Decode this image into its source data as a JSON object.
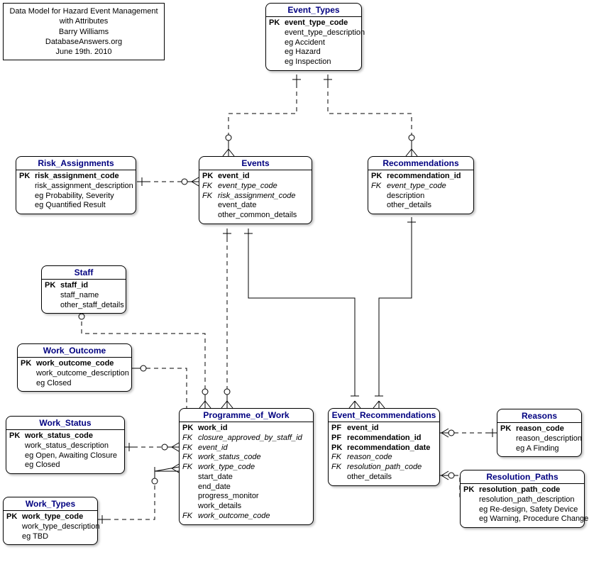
{
  "meta": {
    "line1": "Data Model for Hazard Event Management",
    "line2": "with Attributes",
    "line3": "Barry Williams",
    "line4": "DatabaseAnswers.org",
    "line5": "June 19th. 2010"
  },
  "entities": {
    "event_types": {
      "title": "Event_Types",
      "rows": [
        {
          "key": "PK",
          "attr": "event_type_code",
          "cls": "pk"
        },
        {
          "key": "",
          "attr": "event_type_description"
        },
        {
          "key": "",
          "attr": "eg Accident"
        },
        {
          "key": "",
          "attr": "eg Hazard"
        },
        {
          "key": "",
          "attr": "eg Inspection"
        }
      ]
    },
    "risk_assignments": {
      "title": "Risk_Assignments",
      "rows": [
        {
          "key": "PK",
          "attr": "risk_assignment_code",
          "cls": "pk"
        },
        {
          "key": "",
          "attr": "risk_assignment_description"
        },
        {
          "key": "",
          "attr": "eg Probability, Severity"
        },
        {
          "key": "",
          "attr": "eg Quantified Result"
        }
      ]
    },
    "events": {
      "title": "Events",
      "rows": [
        {
          "key": "PK",
          "attr": "event_id",
          "cls": "pk"
        },
        {
          "key": "FK",
          "attr": "event_type_code",
          "cls": "fk",
          "keycls": "fk"
        },
        {
          "key": "FK",
          "attr": "risk_assignment_code",
          "cls": "fk",
          "keycls": "fk"
        },
        {
          "key": "",
          "attr": "event_date"
        },
        {
          "key": "",
          "attr": "other_common_details"
        }
      ]
    },
    "recommendations": {
      "title": "Recommendations",
      "rows": [
        {
          "key": "PK",
          "attr": "recommendation_id",
          "cls": "pk"
        },
        {
          "key": "FK",
          "attr": "event_type_code",
          "cls": "fk",
          "keycls": "fk"
        },
        {
          "key": "",
          "attr": "description"
        },
        {
          "key": "",
          "attr": "other_details"
        }
      ]
    },
    "staff": {
      "title": "Staff",
      "rows": [
        {
          "key": "PK",
          "attr": "staff_id",
          "cls": "pk"
        },
        {
          "key": "",
          "attr": "staff_name"
        },
        {
          "key": "",
          "attr": "other_staff_details"
        }
      ]
    },
    "work_outcome": {
      "title": "Work_Outcome",
      "rows": [
        {
          "key": "PK",
          "attr": "work_outcome_code",
          "cls": "pk"
        },
        {
          "key": "",
          "attr": "work_outcome_description"
        },
        {
          "key": "",
          "attr": "eg Closed"
        }
      ]
    },
    "work_status": {
      "title": "Work_Status",
      "rows": [
        {
          "key": "PK",
          "attr": "work_status_code",
          "cls": "pk"
        },
        {
          "key": "",
          "attr": "work_status_description"
        },
        {
          "key": "",
          "attr": "eg Open, Awaiting Closure"
        },
        {
          "key": "",
          "attr": "eg Closed"
        }
      ]
    },
    "work_types": {
      "title": "Work_Types",
      "rows": [
        {
          "key": "PK",
          "attr": "work_type_code",
          "cls": "pk"
        },
        {
          "key": "",
          "attr": "work_type_description"
        },
        {
          "key": "",
          "attr": "eg TBD"
        }
      ]
    },
    "programme_of_work": {
      "title": "Programme_of_Work",
      "rows": [
        {
          "key": "PK",
          "attr": "work_id",
          "cls": "pk"
        },
        {
          "key": "FK",
          "attr": "closure_approved_by_staff_id",
          "cls": "fk",
          "keycls": "fk"
        },
        {
          "key": "FK",
          "attr": "event_id",
          "cls": "fk",
          "keycls": "fk"
        },
        {
          "key": "FK",
          "attr": "work_status_code",
          "cls": "fk",
          "keycls": "fk"
        },
        {
          "key": "FK",
          "attr": "work_type_code",
          "cls": "fk",
          "keycls": "fk"
        },
        {
          "key": "",
          "attr": "start_date"
        },
        {
          "key": "",
          "attr": "end_date"
        },
        {
          "key": "",
          "attr": "progress_monitor"
        },
        {
          "key": "",
          "attr": "work_details"
        },
        {
          "key": "FK",
          "attr": "work_outcome_code",
          "cls": "fk",
          "keycls": "fk"
        }
      ]
    },
    "event_recommendations": {
      "title": "Event_Recommendations",
      "rows": [
        {
          "key": "PF",
          "attr": "event_id",
          "cls": "pk",
          "keycls": "pf"
        },
        {
          "key": "PF",
          "attr": "recommendation_id",
          "cls": "pk",
          "keycls": "pf"
        },
        {
          "key": "PK",
          "attr": "recommendation_date",
          "cls": "pk"
        },
        {
          "key": "FK",
          "attr": "reason_code",
          "cls": "fk",
          "keycls": "fk"
        },
        {
          "key": "FK",
          "attr": "resolution_path_code",
          "cls": "fk",
          "keycls": "fk"
        },
        {
          "key": "",
          "attr": "other_details"
        }
      ]
    },
    "reasons": {
      "title": "Reasons",
      "rows": [
        {
          "key": "PK",
          "attr": "reason_code",
          "cls": "pk"
        },
        {
          "key": "",
          "attr": "reason_description"
        },
        {
          "key": "",
          "attr": "eg A Finding"
        }
      ]
    },
    "resolution_paths": {
      "title": "Resolution_Paths",
      "rows": [
        {
          "key": "PK",
          "attr": "resolution_path_code",
          "cls": "pk"
        },
        {
          "key": "",
          "attr": "resolution_path_description"
        },
        {
          "key": "",
          "attr": "eg Re-design, Safety Device"
        },
        {
          "key": "",
          "attr": "eg Warning, Procedure Change"
        }
      ]
    }
  }
}
